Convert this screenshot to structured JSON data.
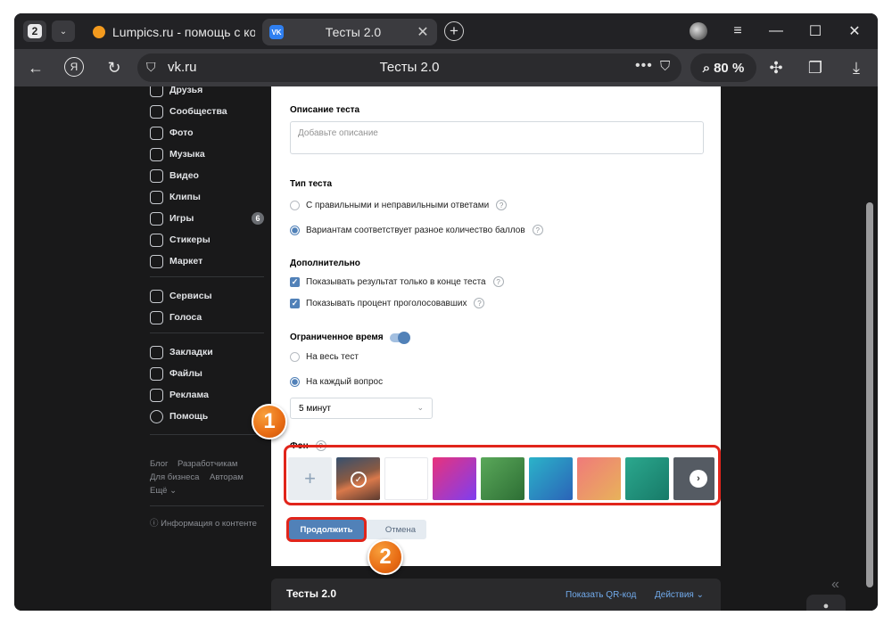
{
  "browser": {
    "tab_count": "2",
    "tabs": [
      {
        "title": "Lumpics.ru - помощь с ко"
      },
      {
        "title": "Тесты 2.0",
        "favicon_text": "VK"
      }
    ],
    "url": "vk.ru",
    "page_title": "Тесты 2.0",
    "zoom": "80 %",
    "glyphs": {
      "back": "←",
      "yandex": "Я",
      "reload": "↻",
      "shield": "⛉",
      "dots": "•••",
      "bookmark": "⛉",
      "extensions": "✣",
      "collections": "❐",
      "download": "⤓",
      "minimize": "—",
      "maximize": "☐",
      "close": "✕",
      "menu": "≡",
      "newtab": "+",
      "tab_close": "✕",
      "chevron": "⌄"
    }
  },
  "sidebar": {
    "items": [
      {
        "label": "Друзья",
        "icon": "friends-icon"
      },
      {
        "label": "Сообщества",
        "icon": "communities-icon"
      },
      {
        "label": "Фото",
        "icon": "photo-icon"
      },
      {
        "label": "Музыка",
        "icon": "music-icon"
      },
      {
        "label": "Видео",
        "icon": "video-icon"
      },
      {
        "label": "Клипы",
        "icon": "clips-icon"
      },
      {
        "label": "Игры",
        "icon": "games-icon",
        "badge": "6"
      },
      {
        "label": "Стикеры",
        "icon": "stickers-icon"
      },
      {
        "label": "Маркет",
        "icon": "market-icon"
      },
      {
        "label": "Сервисы",
        "icon": "services-icon"
      },
      {
        "label": "Голоса",
        "icon": "votes-icon"
      },
      {
        "label": "Закладки",
        "icon": "bookmarks-icon"
      },
      {
        "label": "Файлы",
        "icon": "files-icon"
      },
      {
        "label": "Реклама",
        "icon": "ads-icon"
      },
      {
        "label": "Помощь",
        "icon": "help-icon"
      }
    ],
    "footer": {
      "blog": "Блог",
      "developers": "Разработчикам",
      "business": "Для бизнеса",
      "authors": "Авторам",
      "more": "Ещё ⌄",
      "info": "ⓘ Информация о контенте"
    }
  },
  "form": {
    "description_label": "Описание теста",
    "description_placeholder": "Добавьте описание",
    "type_label": "Тип теста",
    "type_options": [
      {
        "label": "С правильными и неправильными ответами",
        "selected": false
      },
      {
        "label": "Вариантам соответствует разное количество баллов",
        "selected": true
      }
    ],
    "extra_label": "Дополнительно",
    "extra_options": [
      {
        "label": "Показывать результат только в конце теста",
        "checked": true
      },
      {
        "label": "Показывать процент проголосовавших",
        "checked": true
      }
    ],
    "time_label": "Ограниченное время",
    "time_enabled": true,
    "time_options": [
      {
        "label": "На весь тест",
        "selected": false
      },
      {
        "label": "На каждый вопрос",
        "selected": true
      }
    ],
    "time_select_value": "5 минут",
    "background_label": "Фон",
    "help_glyph": "?",
    "add_glyph": "+",
    "check_glyph": "✓",
    "next_glyph": "›",
    "backgrounds": [
      {
        "type": "add"
      },
      {
        "type": "photo",
        "selected": true
      },
      {
        "type": "color",
        "color": "#ffffff"
      },
      {
        "type": "gradient",
        "from": "#e8327c",
        "to": "#7e3ef0"
      },
      {
        "type": "gradient",
        "from": "#4e9a52",
        "to": "#2d6e34"
      },
      {
        "type": "gradient",
        "from": "#2bb3c9",
        "to": "#2b63b8"
      },
      {
        "type": "gradient",
        "from": "#f07a7a",
        "to": "#e8b25a"
      },
      {
        "type": "gradient",
        "from": "#2ba88e",
        "to": "#177a68"
      },
      {
        "type": "more"
      }
    ],
    "continue_label": "Продолжить",
    "cancel_label": "Отмена"
  },
  "annotations": {
    "marker1": "1",
    "marker2": "2",
    "highlight_color": "#e1251b"
  },
  "bottom_bar": {
    "title": "Тесты 2.0",
    "qr_link": "Показать QR-код",
    "actions_link": "Действия ⌄"
  },
  "colors": {
    "accent": "#5181b8",
    "link": "#71aaeb",
    "page_bg": "#19191a",
    "chrome_bg": "#3b3b3f"
  }
}
